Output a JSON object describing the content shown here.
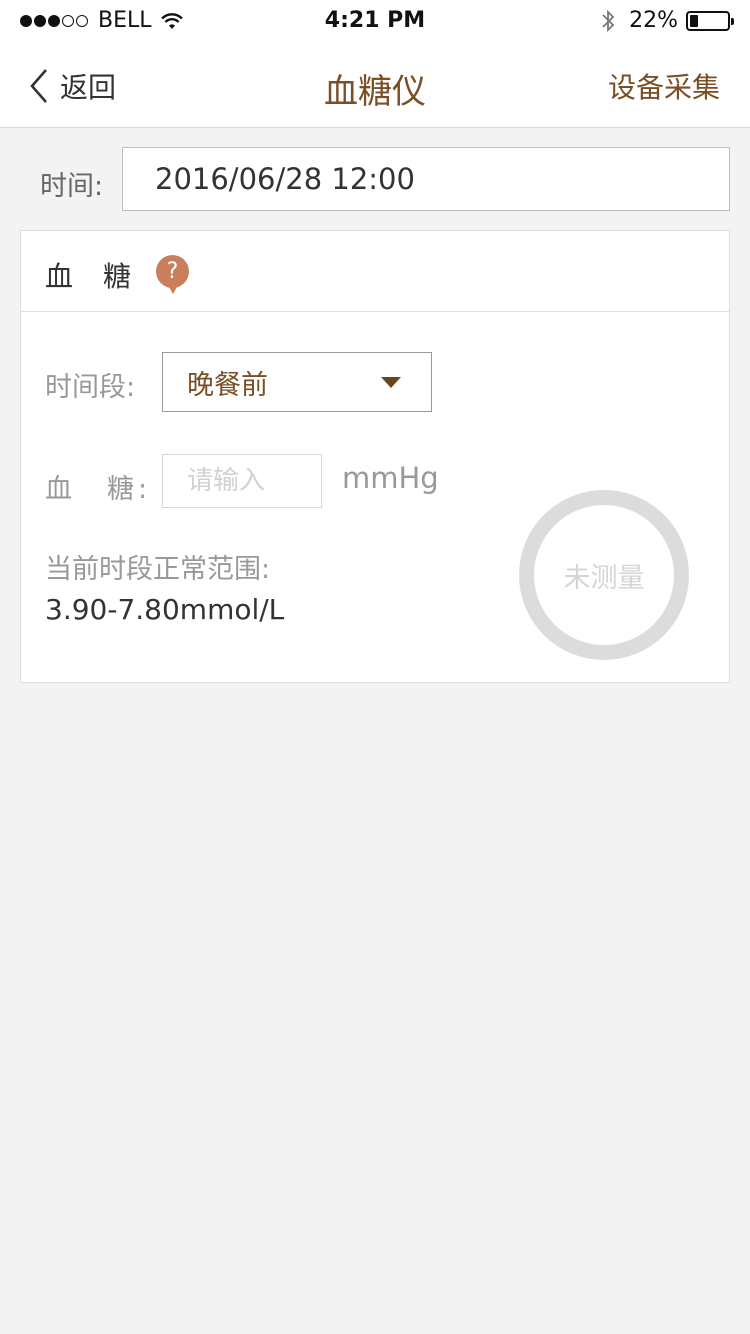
{
  "status_bar": {
    "carrier": "BELL",
    "time": "4:21 PM",
    "battery": "22%",
    "battery_level": 0.22,
    "signal_bars_filled": 3,
    "signal_bars_total": 5
  },
  "nav": {
    "back_label": "返回",
    "title": "血糖仪",
    "action_label": "设备采集"
  },
  "time_row": {
    "label": "时间:",
    "value": "2016/06/28 12:00"
  },
  "card": {
    "title": "血糖",
    "help_icon_text": "?",
    "period_label": "时间段:",
    "period_value": "晚餐前",
    "glucose_label": "血　糖:",
    "glucose_placeholder": "请输入",
    "glucose_value": "",
    "unit": "mmHg",
    "range_label": "当前时段正常范围:",
    "range_value": "3.90-7.80mmol/L",
    "status_text": "未测量"
  },
  "colors": {
    "accent": "#7a4f25",
    "help_icon": "#c97f5c",
    "ring": "#dcdcdc",
    "background": "#f3f3f3"
  }
}
